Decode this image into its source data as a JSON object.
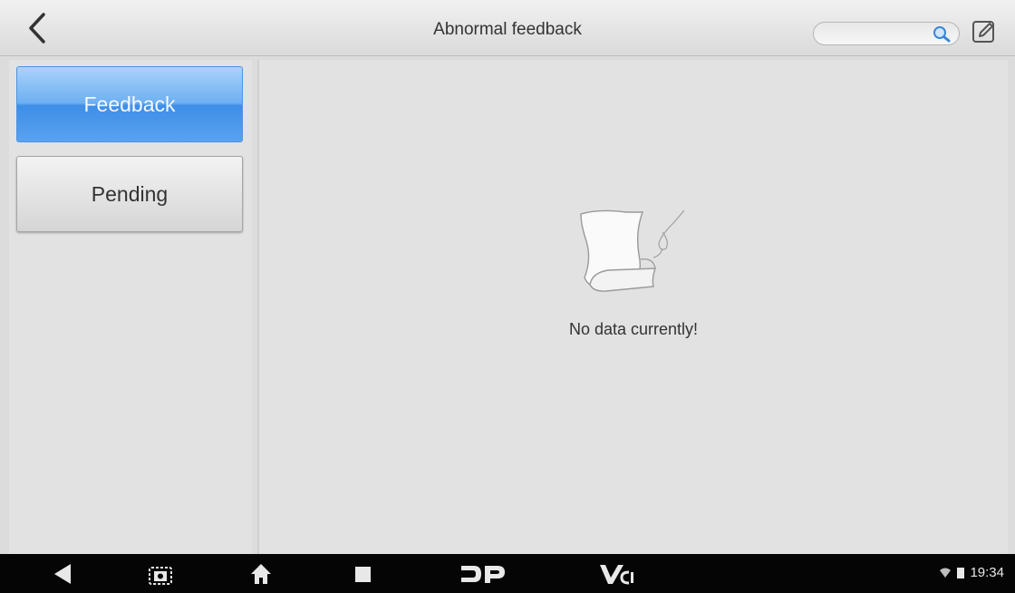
{
  "header": {
    "title": "Abnormal feedback",
    "search_placeholder": ""
  },
  "sidebar": {
    "tabs": [
      {
        "label": "Feedback",
        "active": true
      },
      {
        "label": "Pending",
        "active": false
      }
    ]
  },
  "main": {
    "empty_message": "No data currently!"
  },
  "navbar": {
    "items": [
      "back-icon",
      "screenshot-icon",
      "home-icon",
      "recent-apps-icon",
      "dp-icon",
      "vci-icon"
    ],
    "status": {
      "time": "19:34"
    }
  },
  "colors": {
    "active_tab": "#5aa2ef",
    "background": "#e2e2e2",
    "navbar": "#050505"
  }
}
